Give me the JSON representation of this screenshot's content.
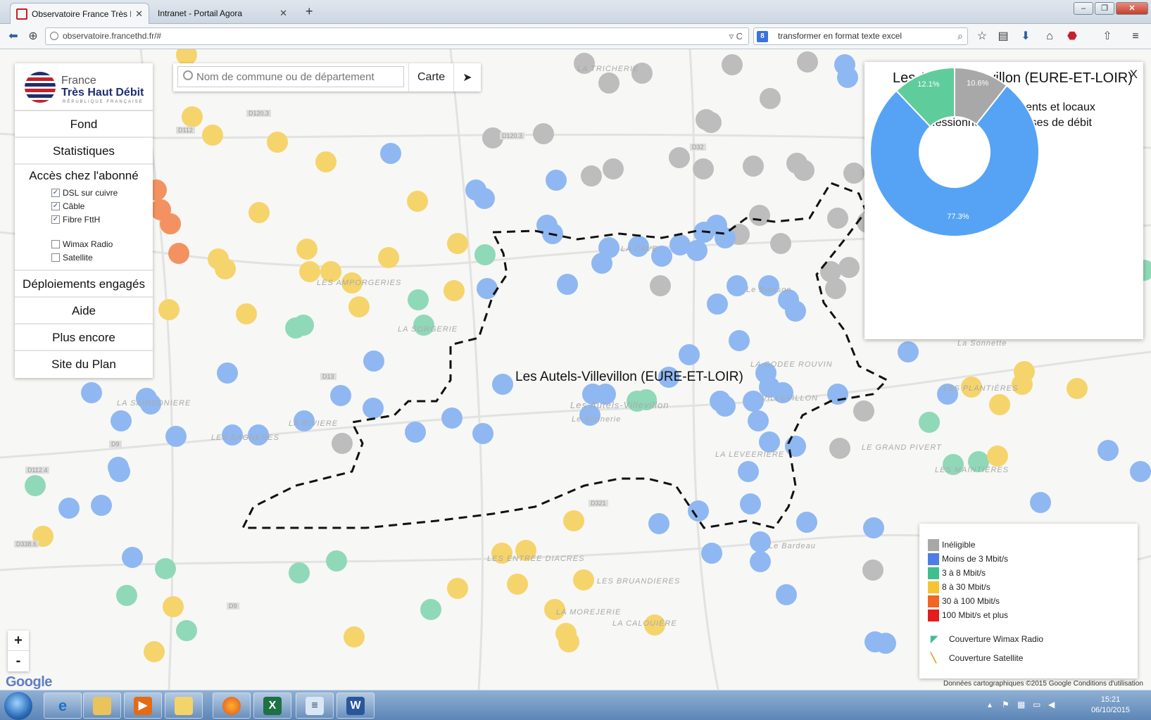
{
  "browser": {
    "tabs": [
      {
        "label": "Observatoire France Très H...",
        "active": true
      },
      {
        "label": "Intranet - Portail Agora",
        "active": false
      }
    ],
    "url": "observatoire.francethd.fr/#",
    "search_text": "transformer en format texte excel",
    "search_engine_icon": "8"
  },
  "logo": {
    "line1": "France",
    "line2": "Très Haut Débit",
    "line3": "RÉPUBLIQUE FRANÇAISE"
  },
  "menu": {
    "fond": "Fond",
    "statistiques": "Statistiques",
    "acces_title": "Accès chez l'abonné",
    "checks": [
      {
        "label": "DSL sur cuivre",
        "checked": true
      },
      {
        "label": "Câble",
        "checked": true
      },
      {
        "label": "Fibre FttH",
        "checked": true
      },
      {
        "label": "Wimax Radio",
        "checked": false
      },
      {
        "label": "Satellite",
        "checked": false
      }
    ],
    "deploiements": "Déploiements engagés",
    "aide": "Aide",
    "plus": "Plus encore",
    "site": "Site du Plan"
  },
  "search": {
    "placeholder": "Nom de commune ou de département",
    "carte_label": "Carte",
    "locate_icon": "location-arrow-icon"
  },
  "map": {
    "commune_label": "Les Autels-Villevillon (EURE-ET-LOIR)",
    "place_labels": [
      "LA TRICHERIE",
      "LA CAVE",
      "LA SORGERIE",
      "LA SAINSONIERE",
      "LA RIVIERE",
      "LES BAGNERES",
      "LES ENTREE DIACRES",
      "LES BRUANDIERES",
      "LA MOREJERIE",
      "LA CALOUIÈRE",
      "LA LEVEERIERE",
      "LES PLANTIÈRES",
      "LES MAINTIÈRES",
      "LE GRAND PIVERT",
      "LA GODEE ROUVIN",
      "VILLEVILLON",
      "Le Buisson",
      "Le Bardeau",
      "La Sonnette",
      "LES AMPORGERIES",
      "Le Sonnerie",
      "Les Autels-Villevillon"
    ],
    "road_labels": [
      "D120.3",
      "D112",
      "D32",
      "D120.3",
      "D13",
      "D112.4",
      "D9",
      "D321",
      "D338.6",
      "D9"
    ],
    "zoom_in": "+",
    "zoom_out": "-",
    "google": "Google",
    "attribution": "Données cartographiques ©2015 Google    Conditions d'utilisation"
  },
  "info": {
    "title": "Les Autels-Villevillon (EURE-ET-LOIR)",
    "close": "X",
    "subtitle_line1": "Pourcentage de logements et locaux",
    "subtitle_line2": "professionnels par classes de débit"
  },
  "chart_data": {
    "type": "pie",
    "title": "Pourcentage de logements et locaux professionnels par classes de débit",
    "slices": [
      {
        "label": "Inéligible",
        "value": 10.6,
        "color": "#a8a8a8",
        "display": "10.6%"
      },
      {
        "label": "Moins de 3 Mbit/s",
        "value": 77.3,
        "color": "#56a3f5",
        "display": "77.3%"
      },
      {
        "label": "3 à 8 Mbit/s",
        "value": 12.1,
        "color": "#5fcc9c",
        "display": "12.1%"
      }
    ]
  },
  "legend": {
    "items": [
      {
        "label": "Inéligible",
        "color": "#a8a8a8"
      },
      {
        "label": "Moins de 3 Mbit/s",
        "color": "#4f7de8"
      },
      {
        "label": "3 à 8 Mbit/s",
        "color": "#3dbf8f"
      },
      {
        "label": "8 à 30 Mbit/s",
        "color": "#f4c531"
      },
      {
        "label": "30 à 100 Mbit/s",
        "color": "#f26522"
      },
      {
        "label": "100 Mbit/s et plus",
        "color": "#e41d1d"
      }
    ],
    "wimax": "Couverture Wimax Radio",
    "satellite": "Couverture Satellite",
    "wimax_color": "#3dbf8f",
    "satellite_color": "#d4a017"
  },
  "taskbar": {
    "time": "15:21",
    "date": "06/10/2015"
  }
}
